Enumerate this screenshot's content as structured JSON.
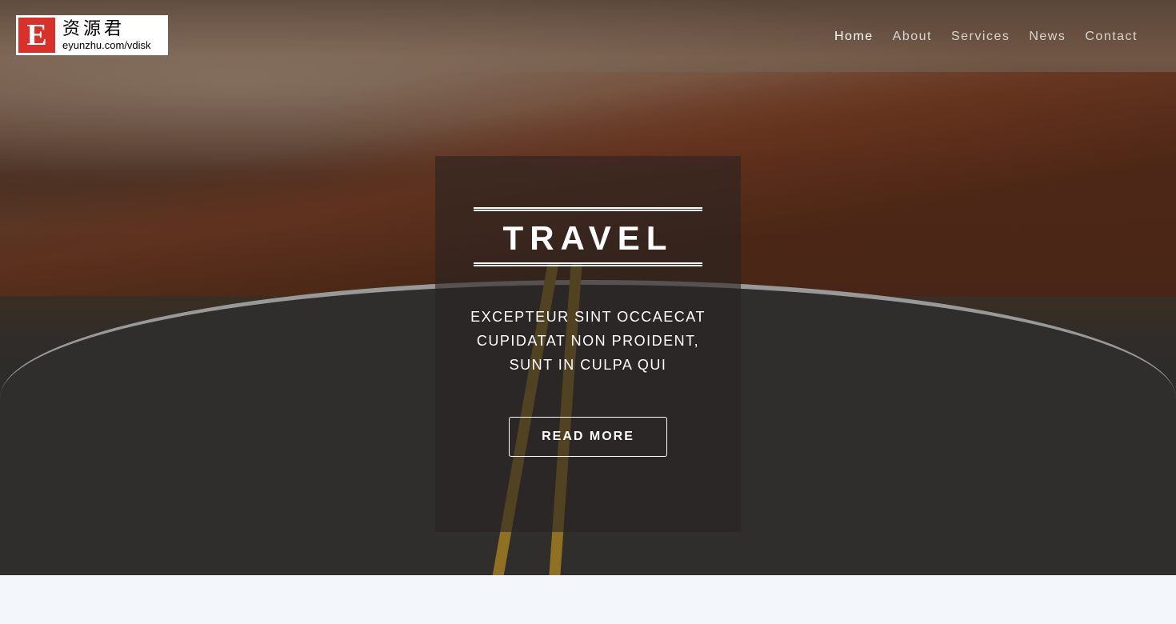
{
  "watermark": {
    "letter": "E",
    "chinese": "资源君",
    "url": "eyunzhu.com/vdisk"
  },
  "nav": {
    "items": [
      {
        "label": "Home",
        "active": true
      },
      {
        "label": "About"
      },
      {
        "label": "Services"
      },
      {
        "label": "News"
      },
      {
        "label": "Contact"
      }
    ]
  },
  "hero": {
    "title": "TRAVEL",
    "description": "EXCEPTEUR SINT OCCAECAT CUPIDATAT NON PROIDENT, SUNT IN CULPA QUI",
    "button": "READ MORE"
  },
  "colors": {
    "overlay": "#2823218f",
    "below": "#f3f6fb"
  }
}
